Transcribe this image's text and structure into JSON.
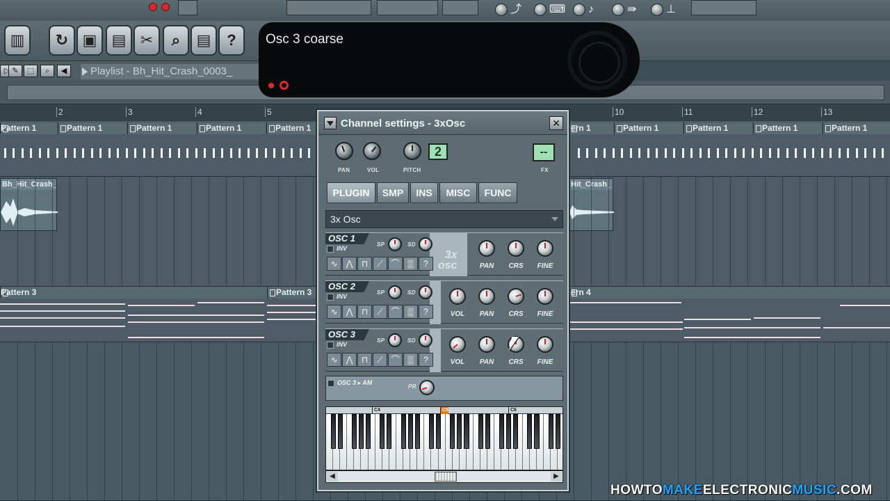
{
  "hint": {
    "text": "Osc 3 coarse"
  },
  "playlist": {
    "title": "Playlist - Bh_Hit_Crash_0003_",
    "bars": [
      "2",
      "3",
      "4",
      "5",
      "10",
      "11",
      "12",
      "13"
    ],
    "pattern1_label": "Pattern 1",
    "audio_clip_label": "Bh_Hit_Crash_",
    "audio_clip_label_right": "Hit_Crash_",
    "pattern3_label": "Pattern 3",
    "pattern4_label": "ern 4",
    "pattern1_partial_right": "ern 1"
  },
  "channel_settings": {
    "title": "Channel settings - 3xOsc",
    "top_knob_labels": {
      "pan": "PAN",
      "vol": "VOL",
      "pitch": "PITCH",
      "fx": "FX"
    },
    "pitch_range_value": "2",
    "fx_value": "--",
    "tabs": [
      "PLUGIN",
      "SMP",
      "INS",
      "MISC",
      "FUNC"
    ],
    "plugin_name": "3x Osc",
    "osc1": {
      "name": "OSC 1",
      "inv": "INV",
      "sp": "SP",
      "sd": "SD",
      "knobs": [
        "PAN",
        "CRS",
        "FINE"
      ],
      "logo_a": "3x",
      "logo_b": "osc"
    },
    "osc2": {
      "name": "OSC 2",
      "inv": "INV",
      "sp": "SP",
      "sd": "SD",
      "knobs": [
        "VOL",
        "PAN",
        "CRS",
        "FINE"
      ]
    },
    "osc3": {
      "name": "OSC 3",
      "inv": "INV",
      "sp": "SP",
      "sd": "SD",
      "knobs": [
        "VOL",
        "PAN",
        "CRS",
        "FINE"
      ]
    },
    "am": {
      "label": "OSC 3 ▸ AM",
      "pr": "PR"
    },
    "wave_glyphs": [
      "∿",
      "⋀",
      "⊓",
      "⟋",
      "⌒",
      "▒",
      "?"
    ],
    "keyboard_markers": [
      "C4",
      "C5",
      "C6"
    ]
  },
  "watermark": {
    "part1": "HOWTO",
    "part2": "MAKE",
    "part3": "ELECTRONIC",
    "part4": "MUSIC",
    "part5": ".COM"
  }
}
